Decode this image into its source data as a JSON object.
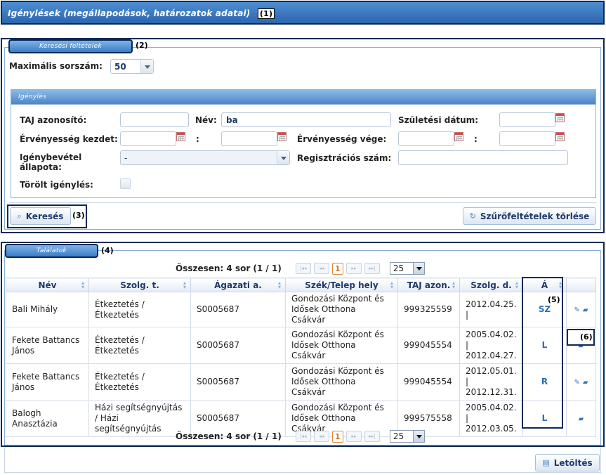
{
  "page": {
    "title": "Igénylések (megállapodások, határozatok adatai)",
    "marker_1": "(1)"
  },
  "search": {
    "tab_label": "Keresési feltételek",
    "marker_2": "(2)",
    "max_rows_label": "Maximális sorszám:",
    "max_rows_value": "50",
    "group_label": "Igénylés",
    "taj_label": "TAJ azonosító:",
    "taj_value": "",
    "name_label": "Név:",
    "name_value": "ba",
    "birth_label": "Születési dátum:",
    "birth_value": "",
    "valid_from_label": "Érvényesség kezdet:",
    "valid_from_date": "",
    "valid_from_time": "",
    "valid_to_label": "Érvényesség vége:",
    "valid_to_date": "",
    "valid_to_time": "",
    "colon": ":",
    "status_label_line1": "Igénybevétel",
    "status_label_line2": "állapota:",
    "status_value": "-",
    "reg_label": "Regisztrációs szám:",
    "reg_value": "",
    "deleted_label": "Törölt igénylés:",
    "search_button": "Keresés",
    "marker_3": "(3)",
    "clear_button": "Szűrőfeltételek törlése"
  },
  "results": {
    "tab_label": "Találatok",
    "marker_4": "(4)",
    "marker_5": "(5)",
    "marker_6": "(6)",
    "pager_text": "Összesen: 4 sor (1 / 1)",
    "current_page": "1",
    "page_size": "25",
    "pager_buttons": [
      "|◂◂",
      "◂◂",
      "▸▸",
      "▸▸|"
    ],
    "columns": [
      "Név",
      "Szolg. t.",
      "Ágazati a.",
      "Szék/Telep hely",
      "TAJ azon.",
      "Szolg. d.",
      "Á"
    ],
    "rows": [
      {
        "name": "Bali Mihály",
        "service": "Étkeztetés / Étkeztetés",
        "code": "S0005687",
        "site": "Gondozási Központ és Idősek Otthona Csákvár",
        "taj": "999325559",
        "date": "2012.04.25. |",
        "status": "SZ",
        "actions": "edit-folder"
      },
      {
        "name": "Fekete Battancs János",
        "service": "Étkeztetés / Étkeztetés",
        "code": "S0005687",
        "site": "Gondozási Központ és Idősek Otthona Csákvár",
        "taj": "999045554",
        "date": "2005.04.02. | 2012.04.27.",
        "status": "L",
        "actions": "folder"
      },
      {
        "name": "Fekete Battancs János",
        "service": "Étkeztetés / Étkeztetés",
        "code": "S0005687",
        "site": "Gondozási Központ és Idősek Otthona Csákvár",
        "taj": "999045554",
        "date": "2012.05.01. | 2012.12.31.",
        "status": "R",
        "actions": "edit-folder"
      },
      {
        "name": "Balogh Anasztázia",
        "service": "Házi segítségnyújtás / Házi segítségnyújtás",
        "code": "S0005687",
        "site": "Gondozási Központ és Idősek Otthona Csákvár",
        "taj": "999575558",
        "date": "2005.04.02. | 2012.03.05.",
        "status": "L",
        "actions": "folder"
      }
    ],
    "download_button": "Letöltés"
  },
  "icons": {
    "search": "magnifier-icon",
    "clear": "refresh-icon",
    "download": "document-icon",
    "calendar": "calendar-icon",
    "edit": "pencil-icon",
    "open": "folder-icon"
  },
  "colors": {
    "title_bar": "#2c66ad",
    "frame": "#0a2a55",
    "link_blue": "#2d6db8",
    "current_page": "#d9731e"
  }
}
